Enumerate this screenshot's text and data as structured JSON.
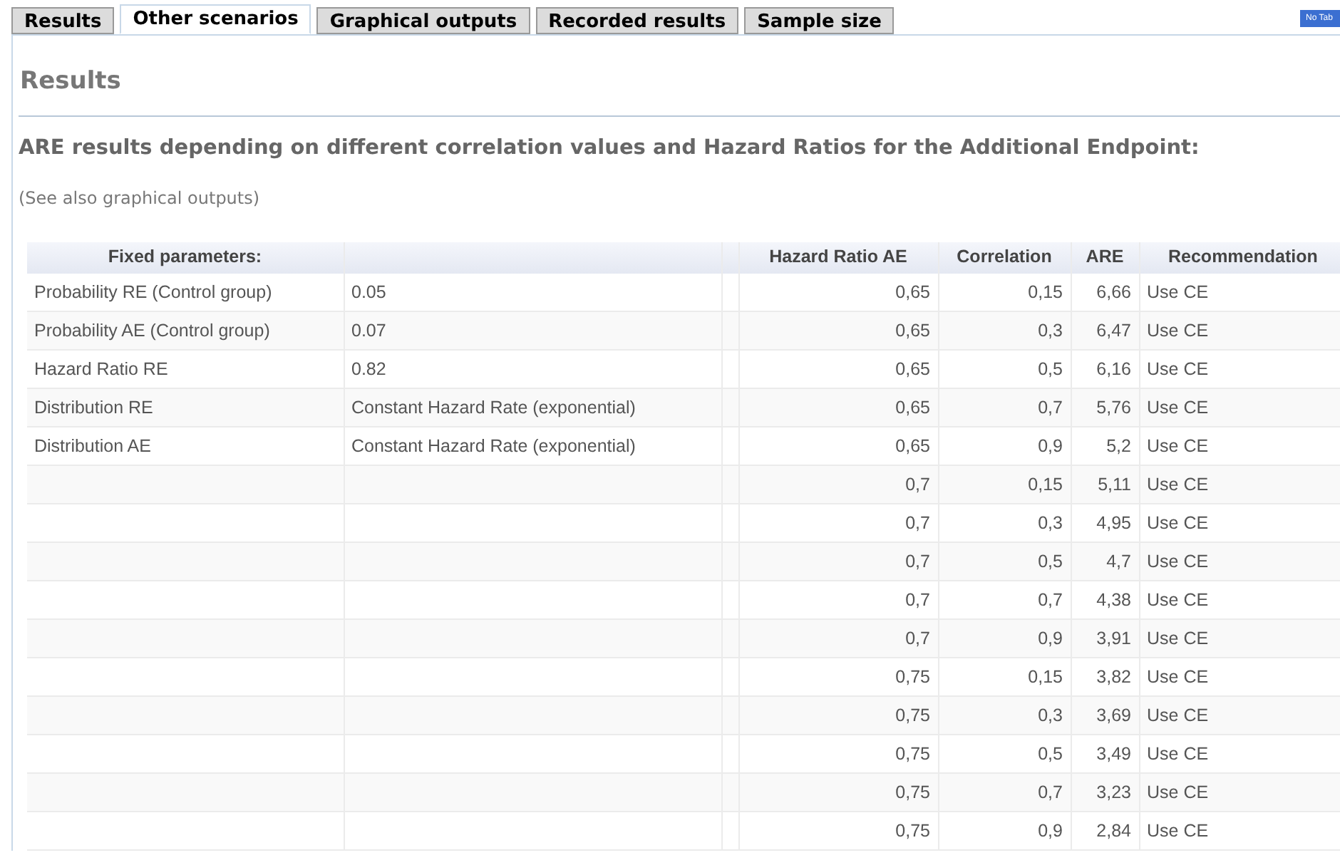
{
  "tabs": [
    {
      "label": "Results",
      "selected": false
    },
    {
      "label": "Other scenarios",
      "selected": true
    },
    {
      "label": "Graphical outputs",
      "selected": false
    },
    {
      "label": "Recorded results",
      "selected": false
    },
    {
      "label": "Sample size",
      "selected": false
    }
  ],
  "badge": "No Tab",
  "title": "Results",
  "subtitle": "ARE results depending on different correlation values and Hazard Ratios for the Additional Endpoint:",
  "note": "(See also graphical outputs)",
  "table": {
    "columns": [
      "Fixed parameters:",
      "Hazard Ratio AE",
      "Correlation",
      "ARE",
      "Recommendation"
    ],
    "rows": [
      {
        "parameter": "Probability RE (Control group)",
        "value": "0.05",
        "hazard_ratio_ae": "0,65",
        "correlation": "0,15",
        "are": "6,66",
        "recommendation": "Use CE"
      },
      {
        "parameter": "Probability AE (Control group)",
        "value": "0.07",
        "hazard_ratio_ae": "0,65",
        "correlation": "0,3",
        "are": "6,47",
        "recommendation": "Use CE"
      },
      {
        "parameter": "Hazard Ratio RE",
        "value": "0.82",
        "hazard_ratio_ae": "0,65",
        "correlation": "0,5",
        "are": "6,16",
        "recommendation": "Use CE"
      },
      {
        "parameter": "Distribution RE",
        "value": "Constant Hazard Rate (exponential)",
        "hazard_ratio_ae": "0,65",
        "correlation": "0,7",
        "are": "5,76",
        "recommendation": "Use CE"
      },
      {
        "parameter": "Distribution AE",
        "value": "Constant Hazard Rate (exponential)",
        "hazard_ratio_ae": "0,65",
        "correlation": "0,9",
        "are": "5,2",
        "recommendation": "Use CE"
      },
      {
        "hazard_ratio_ae": "0,7",
        "correlation": "0,15",
        "are": "5,11",
        "recommendation": "Use CE"
      },
      {
        "hazard_ratio_ae": "0,7",
        "correlation": "0,3",
        "are": "4,95",
        "recommendation": "Use CE"
      },
      {
        "hazard_ratio_ae": "0,7",
        "correlation": "0,5",
        "are": "4,7",
        "recommendation": "Use CE"
      },
      {
        "hazard_ratio_ae": "0,7",
        "correlation": "0,7",
        "are": "4,38",
        "recommendation": "Use CE"
      },
      {
        "hazard_ratio_ae": "0,7",
        "correlation": "0,9",
        "are": "3,91",
        "recommendation": "Use CE"
      },
      {
        "hazard_ratio_ae": "0,75",
        "correlation": "0,15",
        "are": "3,82",
        "recommendation": "Use CE"
      },
      {
        "hazard_ratio_ae": "0,75",
        "correlation": "0,3",
        "are": "3,69",
        "recommendation": "Use CE"
      },
      {
        "hazard_ratio_ae": "0,75",
        "correlation": "0,5",
        "are": "3,49",
        "recommendation": "Use CE"
      },
      {
        "hazard_ratio_ae": "0,75",
        "correlation": "0,7",
        "are": "3,23",
        "recommendation": "Use CE"
      },
      {
        "hazard_ratio_ae": "0,75",
        "correlation": "0,9",
        "are": "2,84",
        "recommendation": "Use CE"
      }
    ]
  }
}
